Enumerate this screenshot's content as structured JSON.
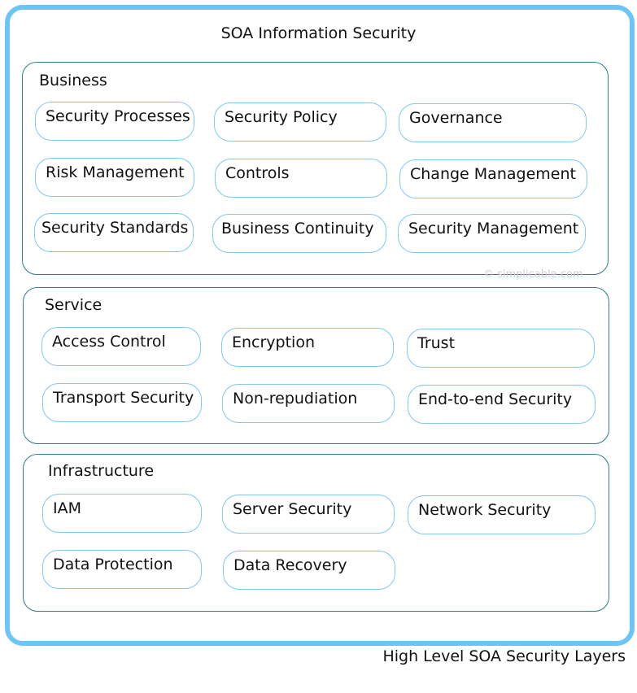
{
  "title": "SOA Information Security",
  "caption": "High Level SOA Security Layers",
  "watermark": "© simplicable.com",
  "layers": [
    {
      "label": "Business",
      "items": [
        "Security Processes",
        "Security Policy",
        "Governance",
        "Risk Management",
        "Controls",
        "Change Management",
        "Security Standards",
        "Business Continuity",
        "Security Management"
      ]
    },
    {
      "label": "Service",
      "items": [
        "Access Control",
        "Encryption",
        "Trust",
        "Transport Security",
        "Non-repudiation",
        "End-to-end Security"
      ]
    },
    {
      "label": "Infrastructure",
      "items": [
        "IAM",
        "Server Security",
        "Network Security",
        "Data Protection",
        "Data Recovery"
      ]
    }
  ]
}
